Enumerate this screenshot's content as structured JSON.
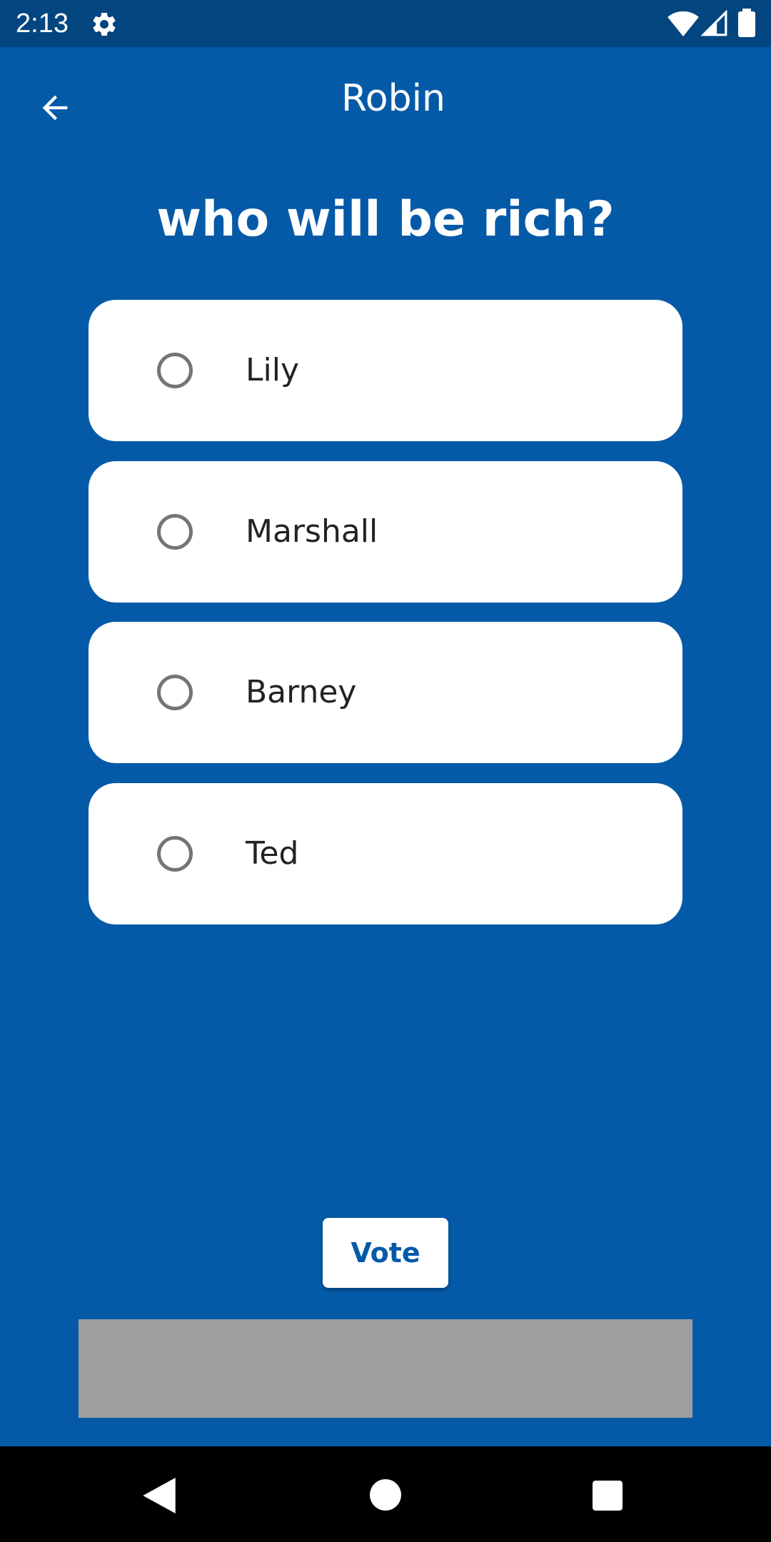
{
  "status_bar": {
    "time": "2:13",
    "icons": [
      "gear-icon",
      "wifi-icon",
      "signal-icon",
      "battery-icon"
    ]
  },
  "app_bar": {
    "title": "Robin",
    "back_icon": "arrow-back-icon"
  },
  "question": "who will be rich?",
  "options": [
    {
      "label": "Lily",
      "selected": false
    },
    {
      "label": "Marshall",
      "selected": false
    },
    {
      "label": "Barney",
      "selected": false
    },
    {
      "label": "Ted",
      "selected": false
    }
  ],
  "vote_button": {
    "label": "Vote"
  },
  "nav_bar": {
    "icons": [
      "nav-back-icon",
      "nav-home-icon",
      "nav-recents-icon"
    ]
  },
  "colors": {
    "background": "#055AA8",
    "status_bar": "#03457F",
    "card": "#FFFFFF",
    "radio_border": "#757575",
    "ad_placeholder": "#9E9E9E"
  }
}
